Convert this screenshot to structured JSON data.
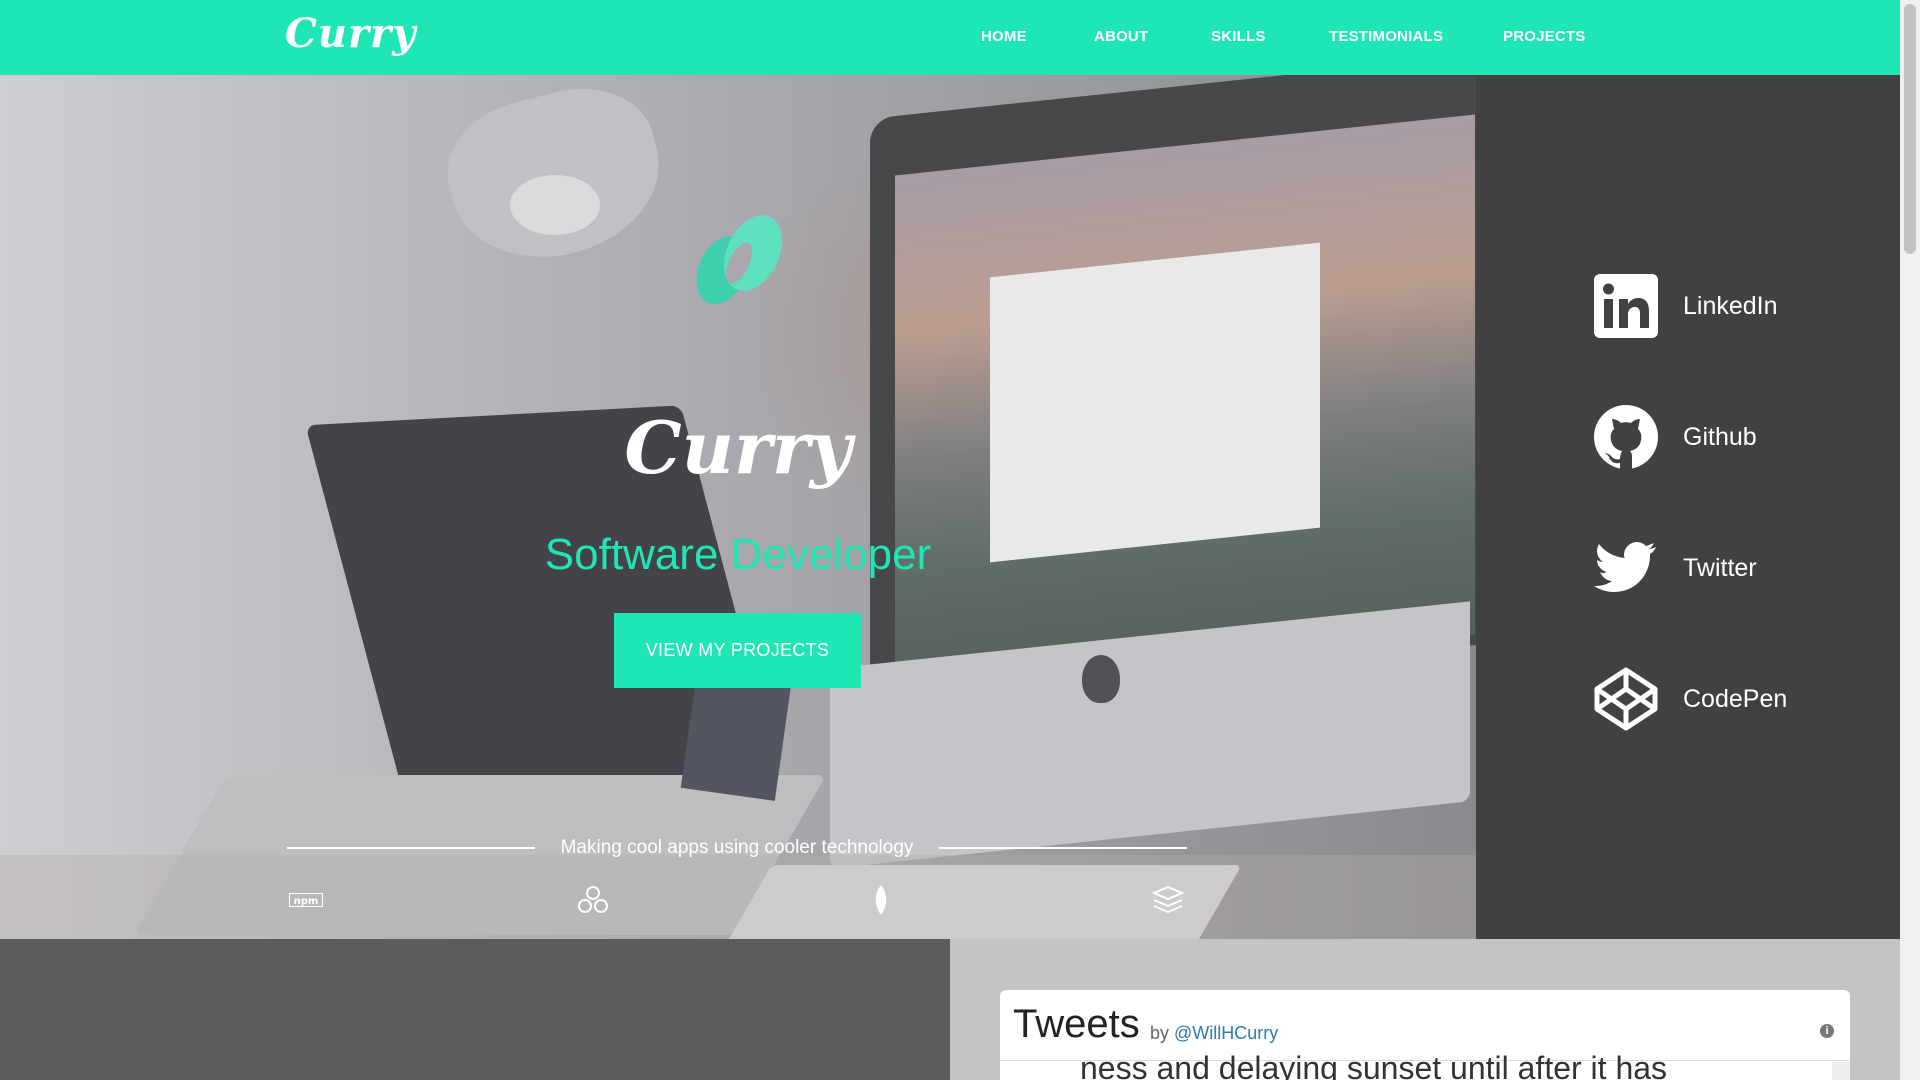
{
  "navbar": {
    "brand": "Curry",
    "links": [
      "HOME",
      "ABOUT",
      "SKILLS",
      "TESTIMONIALS",
      "PROJECTS"
    ]
  },
  "hero": {
    "name": "Curry",
    "role": "Software Developer",
    "cta_label": "VIEW MY PROJECTS",
    "tagline": "Making cool apps using cooler technology",
    "tech_icons": [
      "npm-icon",
      "redux-icon",
      "mongodb-icon",
      "stack-icon"
    ]
  },
  "social": {
    "items": [
      {
        "label": "LinkedIn",
        "icon": "linkedin-icon"
      },
      {
        "label": "Github",
        "icon": "github-icon"
      },
      {
        "label": "Twitter",
        "icon": "twitter-icon"
      },
      {
        "label": "CodePen",
        "icon": "codepen-icon"
      }
    ]
  },
  "tweets": {
    "title": "Tweets",
    "by": "by",
    "handle": "@WillHCurry",
    "snippet": "ness and delaying sunset until after it has"
  },
  "colors": {
    "accent": "#1ee6b5",
    "sidebar": "#414141",
    "lower_left": "#5c5c5c",
    "lower_right": "#c4c4c4"
  }
}
